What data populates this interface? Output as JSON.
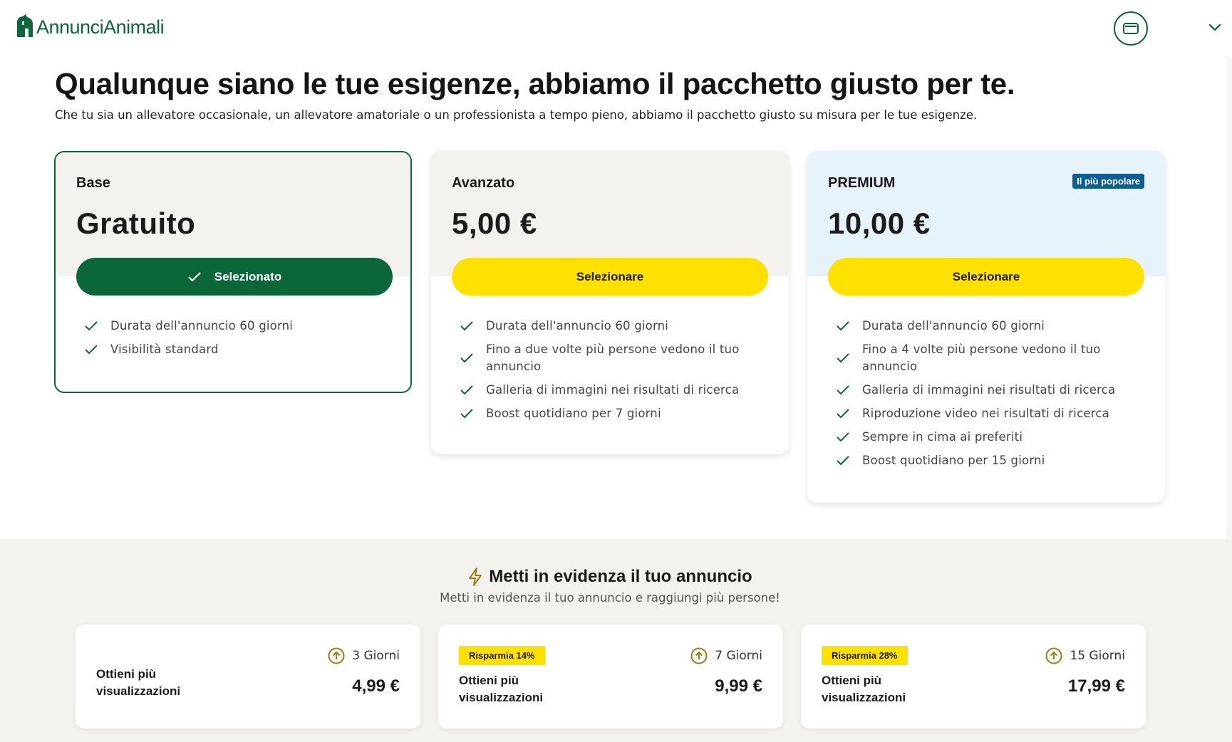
{
  "header": {
    "logo_text": "AnnunciAnimali"
  },
  "hero": {
    "title": "Qualunque siano le tue esigenze, abbiamo il pacchetto giusto per te.",
    "subtitle": "Che tu sia un allevatore occasionale, un allevatore amatoriale o un professionista a tempo pieno, abbiamo il pacchetto giusto su misura per le tue esigenze."
  },
  "plans": [
    {
      "name": "Base",
      "price": "Gratuito",
      "button": "Selezionato",
      "selected": true,
      "features": [
        "Durata dell'annuncio 60 giorni",
        "Visibilità standard"
      ]
    },
    {
      "name": "Avanzato",
      "price": "5,00 €",
      "button": "Selezionare",
      "selected": false,
      "features": [
        "Durata dell'annuncio 60 giorni",
        "Fino a due volte più persone vedono il tuo annuncio",
        "Galleria di immagini nei risultati di ricerca",
        "Boost quotidiano per 7 giorni"
      ]
    },
    {
      "name": "PREMIUM",
      "price": "10,00 €",
      "button": "Selezionare",
      "selected": false,
      "badge": "Il più popolare",
      "features": [
        "Durata dell'annuncio 60 giorni",
        "Fino a 4 volte più persone vedono il tuo annuncio",
        "Galleria di immagini nei risultati di ricerca",
        "Riproduzione video nei risultati di ricerca",
        "Sempre in cima ai preferiti",
        "Boost quotidiano per 15 giorni"
      ]
    }
  ],
  "boost": {
    "title": "Metti in evidenza il tuo annuncio",
    "subtitle": "Metti in evidenza il tuo annuncio e raggiungi più persone!",
    "options": [
      {
        "label": "Ottieni più visualizzazioni",
        "days": "3 Giorni",
        "price": "4,99 €",
        "badge": ""
      },
      {
        "label": "Ottieni più visualizzazioni",
        "days": "7 Giorni",
        "price": "9,99 €",
        "badge": "Risparmia 14%"
      },
      {
        "label": "Ottieni più visualizzazioni",
        "days": "15 Giorni",
        "price": "17,99 €",
        "badge": "Risparmia 28%"
      }
    ]
  },
  "colors": {
    "brand_green": "#0b6639",
    "cta_yellow": "#ffe100",
    "popular_badge": "#0b5e93",
    "avanzato_top": "#f4f2ef",
    "premium_top": "#e6f3fa",
    "boost_bg": "#f4f2ee",
    "days_icon": "#9c7d12"
  }
}
